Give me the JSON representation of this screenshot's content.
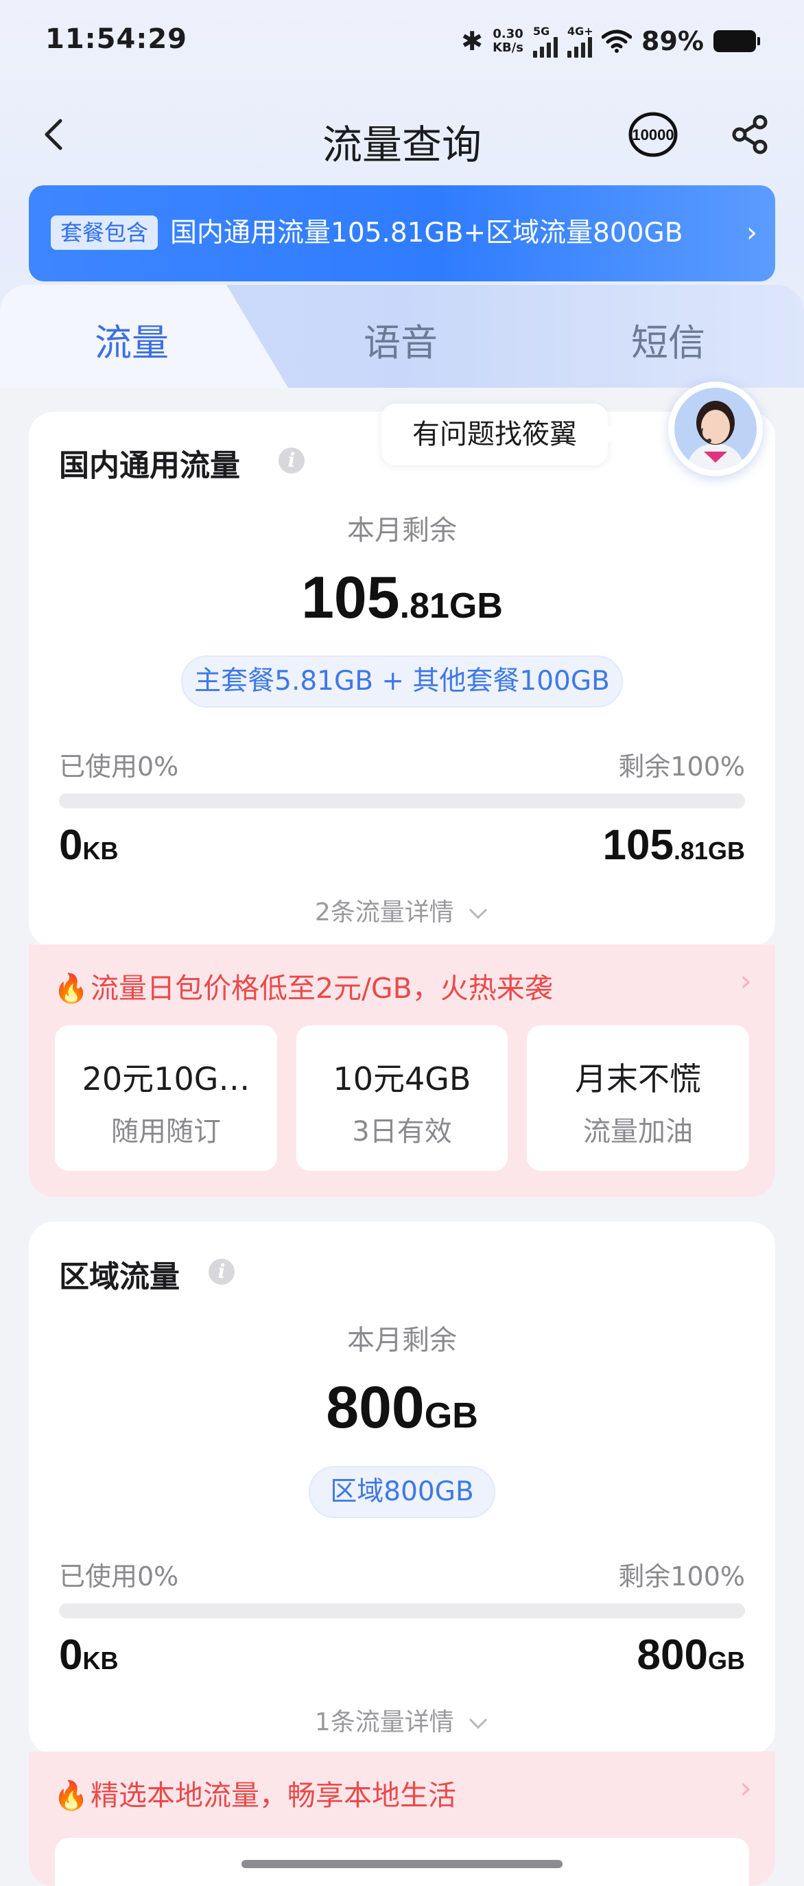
{
  "status_bar": {
    "time": "11:54:29",
    "net_speed_value": "0.30",
    "net_speed_unit": "KB/s",
    "signal_1_label": "5G",
    "signal_2_label": "4G+",
    "battery": "89%"
  },
  "header": {
    "title": "流量查询",
    "service_label": "10000"
  },
  "banner": {
    "tag": "套餐包含",
    "text": "国内通用流量105.81GB+区域流量800GB"
  },
  "tabs": [
    {
      "label": "流量",
      "active": true
    },
    {
      "label": "语音",
      "active": false
    },
    {
      "label": "短信",
      "active": false
    }
  ],
  "assistant": {
    "bubble_text": "有问题找筱翼"
  },
  "domestic": {
    "title": "国内通用流量",
    "remain_label": "本月剩余",
    "remain_int": "105",
    "remain_frac": ".81GB",
    "breakdown": "主套餐5.81GB + 其他套餐100GB",
    "used_label": "已使用0%",
    "left_label": "剩余100%",
    "used_fraction": 0,
    "used_num": "0",
    "used_unit": "KB",
    "left_num": "105",
    "left_unit": ".81GB",
    "detail_link": "2条流量详情"
  },
  "promo1": {
    "headline": "流量日包价格低至2元/GB，火热来袭",
    "items": [
      {
        "title": "20元10G…",
        "sub": "随用随订"
      },
      {
        "title": "10元4GB",
        "sub": "3日有效"
      },
      {
        "title": "月末不慌",
        "sub": "流量加油"
      }
    ]
  },
  "regional": {
    "title": "区域流量",
    "remain_label": "本月剩余",
    "remain_int": "800",
    "remain_frac": "GB",
    "breakdown": "区域800GB",
    "used_label": "已使用0%",
    "left_label": "剩余100%",
    "used_fraction": 0,
    "used_num": "0",
    "used_unit": "KB",
    "left_num": "800",
    "left_unit": "GB",
    "detail_link": "1条流量详情"
  },
  "promo2": {
    "headline": "精选本地流量，畅享本地生活"
  },
  "colors": {
    "accent": "#3f78e6",
    "banner": "#2f7cff",
    "promo_bg": "#fde6ea",
    "promo_text": "#ea4a4a"
  }
}
